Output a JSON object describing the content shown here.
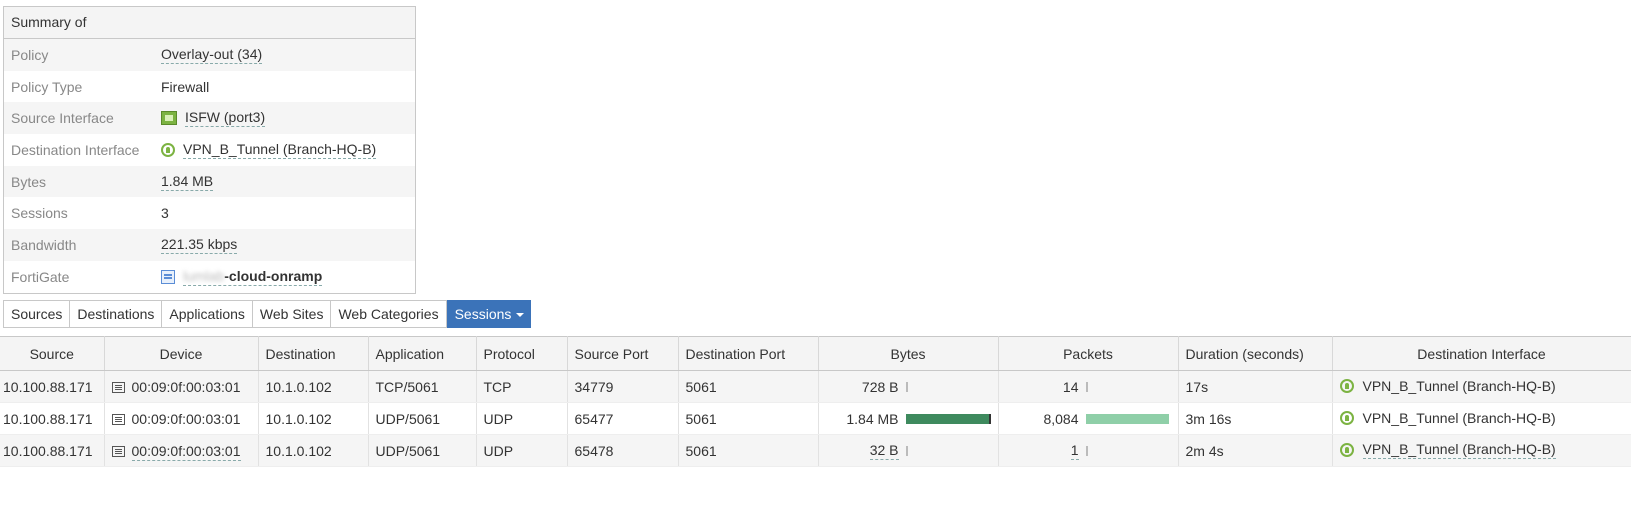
{
  "summary": {
    "title": "Summary of",
    "rows": [
      {
        "key": "Policy",
        "value": "Overlay-out (34)",
        "dashed": true
      },
      {
        "key": "Policy Type",
        "value": "Firewall",
        "dashed": false
      },
      {
        "key": "Source Interface",
        "value": "ISFW (port3)",
        "icon": "interface-port-icon",
        "dashed": true
      },
      {
        "key": "Destination Interface",
        "value": "VPN_B_Tunnel (Branch-HQ-B)",
        "icon": "vpn-tunnel-icon",
        "dashed": true
      },
      {
        "key": "Bytes",
        "value": "1.84 MB",
        "dashed": true
      },
      {
        "key": "Sessions",
        "value": "3",
        "dashed": false
      },
      {
        "key": "Bandwidth",
        "value": "221.35 kbps",
        "dashed": true
      },
      {
        "key": "FortiGate",
        "value_blurred": "lumlab",
        "value": "-cloud-onramp",
        "icon": "fortigate-device-icon",
        "dashed": true
      }
    ]
  },
  "tabs": [
    {
      "label": "Sources",
      "active": false
    },
    {
      "label": "Destinations",
      "active": false
    },
    {
      "label": "Applications",
      "active": false
    },
    {
      "label": "Web Sites",
      "active": false
    },
    {
      "label": "Web Categories",
      "active": false
    },
    {
      "label": "Sessions",
      "active": true
    }
  ],
  "sessions": {
    "columns": [
      "Source",
      "Device",
      "Destination",
      "Application",
      "Protocol",
      "Source Port",
      "Destination Port",
      "Bytes",
      "Packets",
      "Duration (seconds)",
      "Destination Interface"
    ],
    "rows": [
      {
        "source": "10.100.88.171",
        "device": "00:09:0f:00:03:01",
        "destination": "10.1.0.102",
        "application": "TCP/5061",
        "protocol": "TCP",
        "source_port": "34779",
        "destination_port": "5061",
        "bytes": "728 B",
        "bytes_fraction": 0.0004,
        "packets": "14",
        "packets_fraction": 0.0017,
        "duration": "17s",
        "dst_interface": "VPN_B_Tunnel (Branch-HQ-B)"
      },
      {
        "source": "10.100.88.171",
        "device": "00:09:0f:00:03:01",
        "destination": "10.1.0.102",
        "application": "UDP/5061",
        "protocol": "UDP",
        "source_port": "65477",
        "destination_port": "5061",
        "bytes": "1.84 MB",
        "bytes_fraction": 1.0,
        "packets": "8,084",
        "packets_fraction": 1.0,
        "duration": "3m 16s",
        "dst_interface": "VPN_B_Tunnel (Branch-HQ-B)"
      },
      {
        "source": "10.100.88.171",
        "device": "00:09:0f:00:03:01",
        "destination": "10.1.0.102",
        "application": "UDP/5061",
        "protocol": "UDP",
        "source_port": "65478",
        "destination_port": "5061",
        "bytes": "32 B",
        "bytes_fraction": 0.0,
        "packets": "1",
        "packets_fraction": 0.0,
        "duration": "2m 4s",
        "dst_interface": "VPN_B_Tunnel (Branch-HQ-B)"
      }
    ]
  },
  "colors": {
    "accent": "#3b73b9",
    "bytes_bar": "#3e8a5e",
    "packets_bar": "#8fcfa8",
    "interface_icon": "#7cb342"
  }
}
